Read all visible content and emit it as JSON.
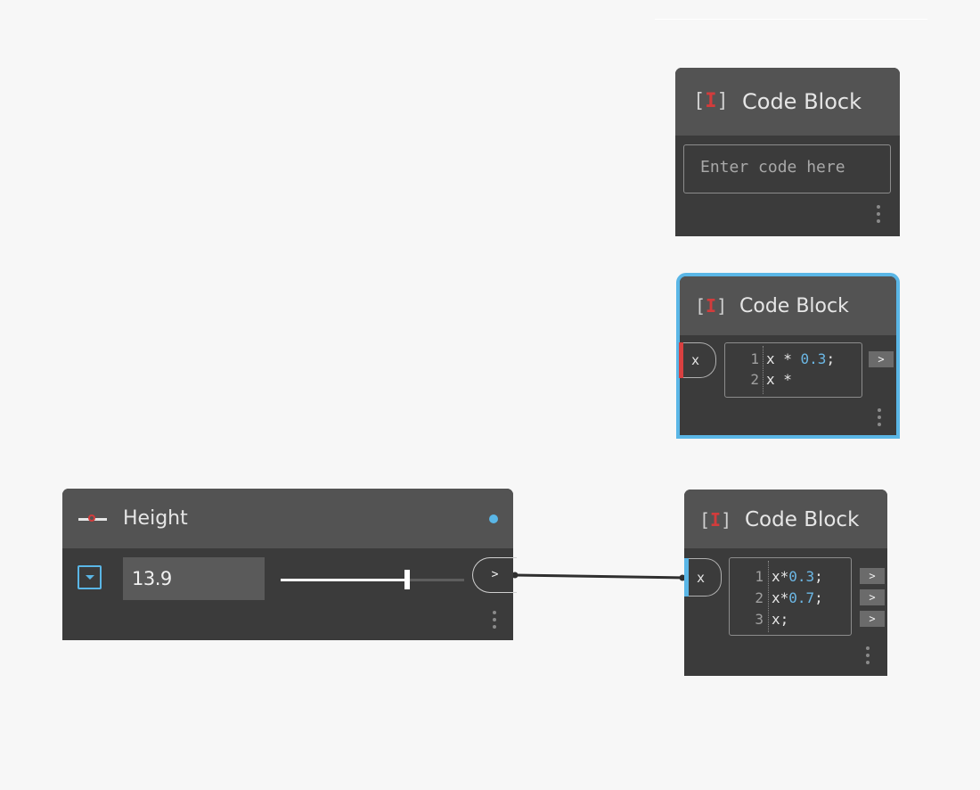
{
  "nodes": {
    "code_block_empty": {
      "title": "Code Block",
      "icon": "code-block-icon",
      "placeholder": "Enter code here"
    },
    "code_block_selected": {
      "title": "Code Block",
      "icon": "code-block-icon",
      "input_port": "x",
      "output_ports": [
        ">"
      ],
      "lines": [
        {
          "no": "1",
          "parts": [
            "x * ",
            "0.3",
            ";"
          ]
        },
        {
          "no": "2",
          "parts": [
            "x *",
            "",
            ""
          ]
        }
      ],
      "selected": true,
      "input_port_state_color": "#d94040"
    },
    "code_block_connected": {
      "title": "Code Block",
      "icon": "code-block-icon",
      "input_port": "x",
      "output_ports": [
        ">",
        ">",
        ">"
      ],
      "lines": [
        {
          "no": "1",
          "parts": [
            "x*",
            "0.3",
            ";"
          ]
        },
        {
          "no": "2",
          "parts": [
            "x*",
            "0.7",
            ";"
          ]
        },
        {
          "no": "3",
          "parts": [
            "x;",
            "",
            ""
          ]
        }
      ],
      "input_port_state_color": "#5ab6e6"
    },
    "height_slider": {
      "title": "Height",
      "icon": "number-slider-icon",
      "value": "13.9",
      "slider_fraction": 0.69,
      "output_port": ">"
    }
  },
  "colors": {
    "canvas": "#f7f7f7",
    "node_body": "#3b3b3b",
    "node_header": "#535353",
    "selection": "#5ab6e6",
    "number_literal": "#6cb8e6",
    "error_port": "#d94040"
  }
}
